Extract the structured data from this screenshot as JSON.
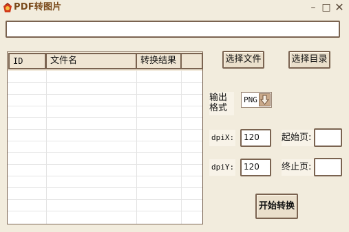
{
  "window": {
    "title": "PDF转图片"
  },
  "titlebar": {
    "min": "–",
    "max": "□",
    "close": "✕"
  },
  "path_field": {
    "value": ""
  },
  "grid": {
    "columns": [
      "ID",
      "文件名",
      "转换结果"
    ],
    "rows": []
  },
  "buttons": {
    "select_file": "选择文件",
    "select_dir": "选择目录",
    "start": "开始转换"
  },
  "format": {
    "label": "输出格式",
    "value": "PNG"
  },
  "dpi": {
    "x_label": "dpiX:",
    "x_value": "120",
    "y_label": "dpiY:",
    "y_value": "120"
  },
  "pages": {
    "start_label": "起始页:",
    "start_value": "",
    "end_label": "终止页:",
    "end_value": ""
  },
  "icons": {
    "app": "pdf-app-icon",
    "dropdown": "arrow-down-icon"
  },
  "colors": {
    "background": "#f2ecdd",
    "border": "#7a6350",
    "title": "#7a4a1b",
    "button": "#eadfcb"
  }
}
